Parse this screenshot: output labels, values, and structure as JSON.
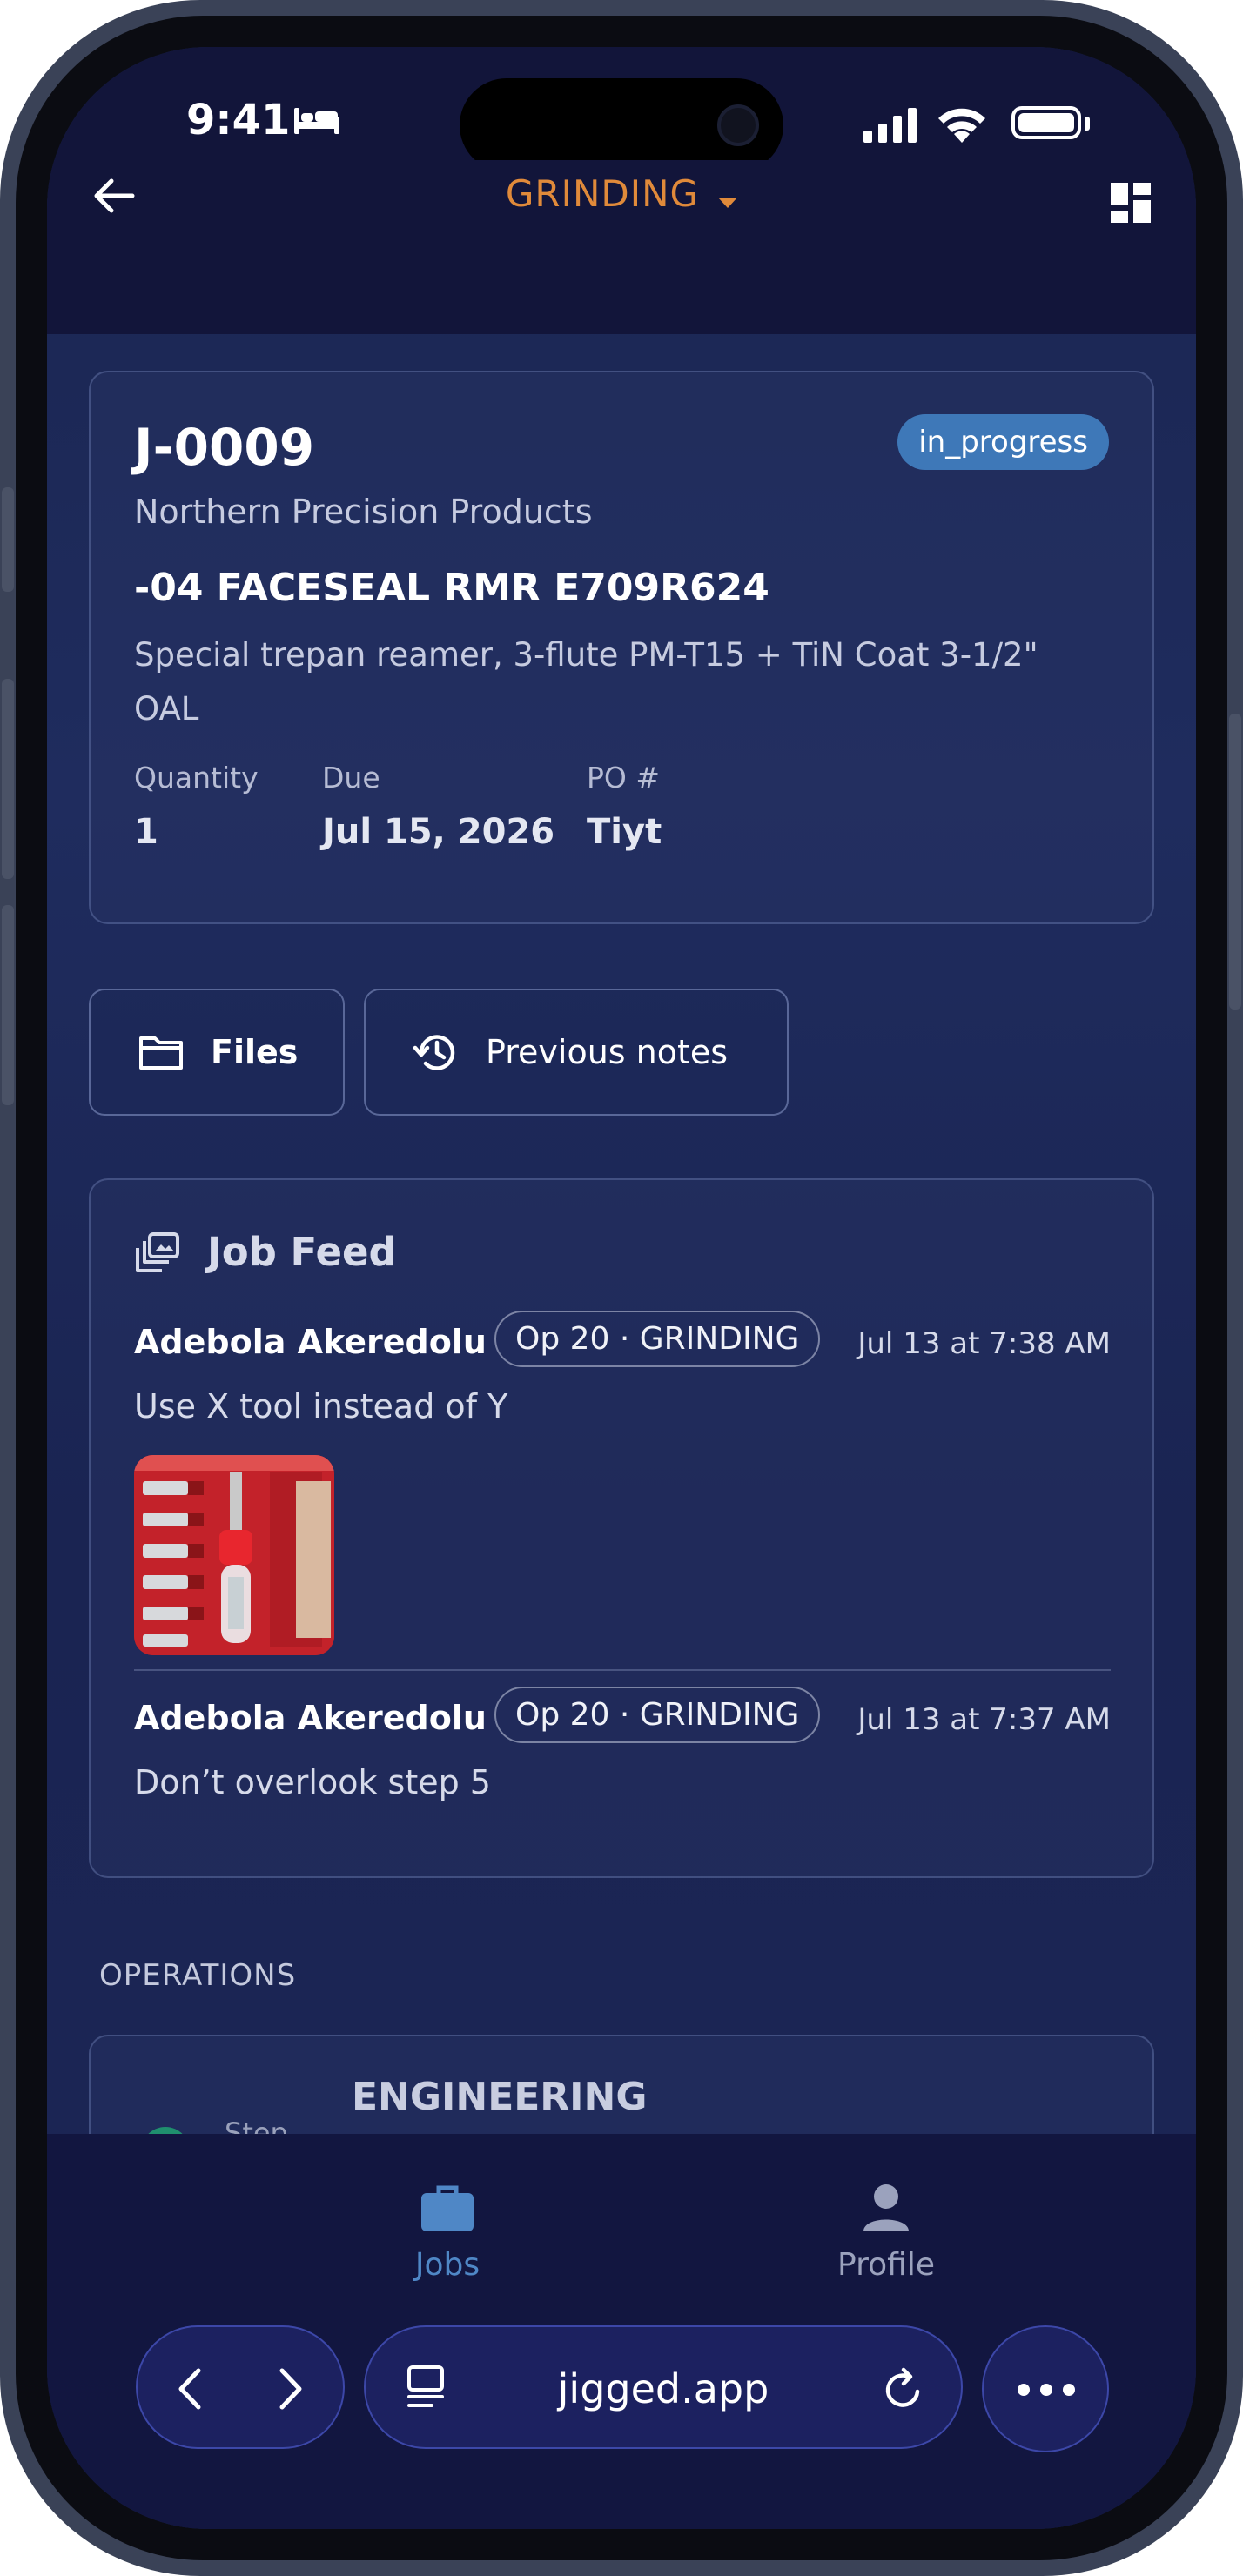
{
  "status_bar": {
    "time": "9:41"
  },
  "app_bar": {
    "title": "GRINDING"
  },
  "job": {
    "id": "J-0009",
    "status": "in_progress",
    "customer": "Northern Precision Products",
    "part_number": "-04 FACESEAL RMR E709R624",
    "description": "Special trepan reamer, 3-flute PM-T15 + TiN Coat 3-1/2\" OAL",
    "meta": [
      {
        "label": "Quantity",
        "value": "1"
      },
      {
        "label": "Due",
        "value": "Jul 15, 2026"
      },
      {
        "label": "PO #",
        "value": "Tiyt"
      }
    ]
  },
  "actions": {
    "files": "Files",
    "previous_notes": "Previous notes"
  },
  "feed": {
    "title": "Job Feed",
    "entries": [
      {
        "author": "Adebola Akeredolu",
        "op": "Op 20 · GRINDING",
        "time": "Jul 13 at 7:38 AM",
        "text": "Use X tool instead of Y",
        "has_image": true
      },
      {
        "author": "Adebola Akeredolu",
        "op": "Op 20 · GRINDING",
        "time": "Jul 13 at 7:37 AM",
        "text": "Don’t overlook step 5",
        "has_image": false
      }
    ]
  },
  "operations": {
    "label": "OPERATIONS",
    "items": [
      {
        "name": "ENGINEERING",
        "step_label": "Step"
      }
    ]
  },
  "bottom_nav": {
    "tabs": [
      {
        "label": "Jobs",
        "active": true
      },
      {
        "label": "Profile",
        "active": false
      }
    ]
  },
  "browser": {
    "url": "jigged.app"
  },
  "colors": {
    "accent_orange": "#e08a3a",
    "badge_blue": "#3e78b8",
    "active_tab": "#4f87c6"
  }
}
